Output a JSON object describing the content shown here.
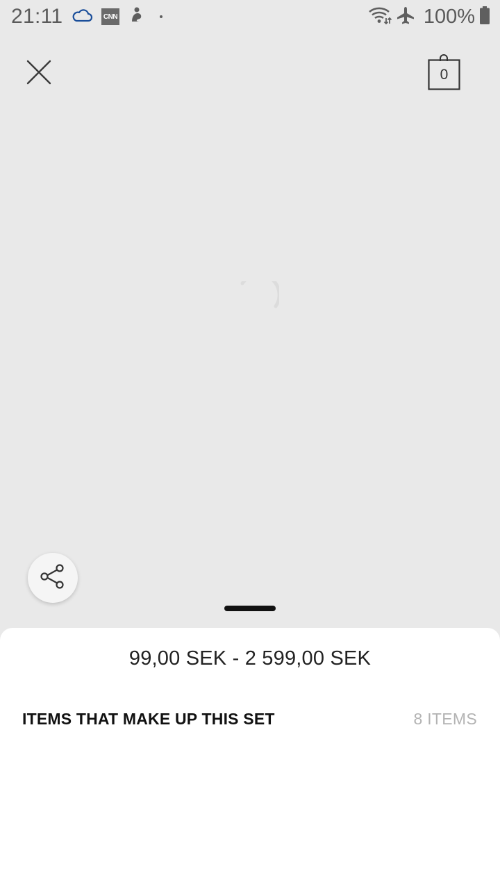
{
  "status_bar": {
    "time": "21:11",
    "battery": "100%",
    "left_icons": [
      "cloud-icon",
      "cnn-icon",
      "app-notification-icon",
      "dot-icon"
    ],
    "cnn_label": "CNN",
    "right_icons": [
      "wifi-icon",
      "airplane-mode-icon",
      "battery-icon"
    ]
  },
  "header": {
    "close_icon": "close-icon",
    "bag_icon": "shopping-bag-icon",
    "bag_count": "0"
  },
  "content": {
    "loading_indicator": "spinner-icon"
  },
  "share": {
    "icon": "share-icon"
  },
  "sheet": {
    "price_range": "99,00 SEK - 2 599,00 SEK",
    "section_title": "ITEMS THAT MAKE UP THIS SET",
    "items_count": "8 ITEMS"
  },
  "colors": {
    "background": "#e9e9e9",
    "sheet_background": "#ffffff",
    "cloud_blue": "#1a4e9a",
    "muted_text": "#b3b3b3"
  }
}
